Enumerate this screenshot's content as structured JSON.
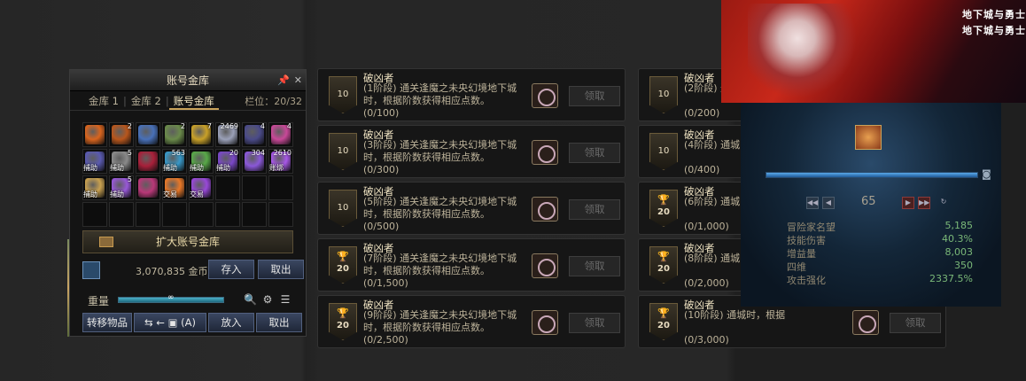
{
  "storage": {
    "title": "账号金库",
    "pin_icon": "pin-icon",
    "close_label": "✕",
    "tabs": [
      {
        "label": "金库 1"
      },
      {
        "label": "金库 2"
      },
      {
        "label": "账号金库"
      }
    ],
    "slots": "栏位：20/32",
    "items": [
      {
        "icon": "orange-mask",
        "color": "#d8641e",
        "count": "",
        "tag": ""
      },
      {
        "icon": "orange-golem",
        "color": "#b8561c",
        "count": "2",
        "tag": ""
      },
      {
        "icon": "blue-golem",
        "color": "#4870b8",
        "count": "",
        "tag": ""
      },
      {
        "icon": "green-bot",
        "color": "#6a8a4a",
        "count": "2",
        "tag": ""
      },
      {
        "icon": "gold-scroll",
        "color": "#c8a028",
        "count": "7",
        "tag": ""
      },
      {
        "icon": "silver-card",
        "color": "#9aa0b8",
        "count": "2469",
        "tag": ""
      },
      {
        "icon": "rune-stone",
        "color": "#4a4a88",
        "count": "4",
        "tag": ""
      },
      {
        "icon": "pink-orb",
        "color": "#c84898",
        "count": "4",
        "tag": ""
      },
      {
        "icon": "rune-box",
        "color": "#5a5ab0",
        "count": "",
        "tag": "捕助"
      },
      {
        "icon": "hammer-tools",
        "color": "#8a8a8a",
        "count": "5",
        "tag": "捕助"
      },
      {
        "icon": "red-potion",
        "color": "#a8203a",
        "count": "",
        "tag": ""
      },
      {
        "icon": "blue-crystal",
        "color": "#3898c8",
        "count": "563",
        "tag": "捕助"
      },
      {
        "icon": "green-flask",
        "color": "#58a848",
        "count": "",
        "tag": "捕助"
      },
      {
        "icon": "purple-gem",
        "color": "#7a48c8",
        "count": "20",
        "tag": "捕助"
      },
      {
        "icon": "purple-ring",
        "color": "#8a58d8",
        "count": "304",
        "tag": ""
      },
      {
        "icon": "violet-rune",
        "color": "#a858e8",
        "count": "2610",
        "tag": "账绑"
      },
      {
        "icon": "amber-jar",
        "color": "#c8a050",
        "count": "",
        "tag": "捕助"
      },
      {
        "icon": "magic-wand",
        "color": "#9858d8",
        "count": "5",
        "tag": "捕助"
      },
      {
        "icon": "pink-chest",
        "color": "#b83878",
        "count": "",
        "tag": ""
      },
      {
        "icon": "fire-orb",
        "color": "#e87828",
        "count": "",
        "tag": "交易"
      },
      {
        "icon": "violet-orb",
        "color": "#9848d8",
        "count": "",
        "tag": "交易"
      },
      {
        "icon": "",
        "color": "",
        "count": "",
        "tag": ""
      },
      {
        "icon": "",
        "color": "",
        "count": "",
        "tag": ""
      },
      {
        "icon": "",
        "color": "",
        "count": "",
        "tag": ""
      },
      {
        "icon": "",
        "color": "",
        "count": "",
        "tag": ""
      },
      {
        "icon": "",
        "color": "",
        "count": "",
        "tag": ""
      },
      {
        "icon": "",
        "color": "",
        "count": "",
        "tag": ""
      },
      {
        "icon": "",
        "color": "",
        "count": "",
        "tag": ""
      },
      {
        "icon": "",
        "color": "",
        "count": "",
        "tag": ""
      },
      {
        "icon": "",
        "color": "",
        "count": "",
        "tag": ""
      },
      {
        "icon": "",
        "color": "",
        "count": "",
        "tag": ""
      },
      {
        "icon": "",
        "color": "",
        "count": "",
        "tag": ""
      }
    ],
    "expand_label": "扩大账号金库",
    "gold_amount": "3,070,835",
    "gold_unit": "金币",
    "deposit_label": "存入",
    "withdraw_label": "取出",
    "weight_label": "重量",
    "weight_value": "∞",
    "transfer_label": "转移物品",
    "transfer_hotkey": "(A)",
    "put_label": "放入",
    "take_label": "取出"
  },
  "achievements": {
    "claim_label": "领取",
    "left": [
      {
        "name": "破凶者",
        "desc": "(1阶段) 通关逢魔之未央幻境地下城时，根据阶数获得相应点数。",
        "progress": "(0/100)",
        "medal": "10",
        "trophy": false
      },
      {
        "name": "破凶者",
        "desc": "(3阶段) 通关逢魔之未央幻境地下城时，根据阶数获得相应点数。",
        "progress": "(0/300)",
        "medal": "10",
        "trophy": false
      },
      {
        "name": "破凶者",
        "desc": "(5阶段) 通关逢魔之未央幻境地下城时，根据阶数获得相应点数。",
        "progress": "(0/500)",
        "medal": "10",
        "trophy": false
      },
      {
        "name": "破凶者",
        "desc": "(7阶段) 通关逢魔之未央幻境地下城时，根据阶数获得相应点数。",
        "progress": "(0/1,500)",
        "medal": "20",
        "trophy": true
      },
      {
        "name": "破凶者",
        "desc": "(9阶段) 通关逢魔之未央幻境地下城时，根据阶数获得相应点数。",
        "progress": "(0/2,500)",
        "medal": "20",
        "trophy": true
      }
    ],
    "right": [
      {
        "name": "破凶者",
        "desc": "(2阶段) 通城时，根据",
        "progress": "(0/200)",
        "medal": "10",
        "trophy": false
      },
      {
        "name": "破凶者",
        "desc": "(4阶段) 通城时，根据",
        "progress": "(0/400)",
        "medal": "10",
        "trophy": false
      },
      {
        "name": "破凶者",
        "desc": "(6阶段) 通城时，根据",
        "progress": "(0/1,000)",
        "medal": "20",
        "trophy": true
      },
      {
        "name": "破凶者",
        "desc": "(8阶段) 通城时，根据",
        "progress": "(0/2,000)",
        "medal": "20",
        "trophy": true
      },
      {
        "name": "破凶者",
        "desc": "(10阶段) 通城时，根据",
        "progress": "(0/3,000)",
        "medal": "20",
        "trophy": true
      }
    ]
  },
  "banner": {
    "logo1": "地下城与勇士",
    "logo2": "地下城与勇士"
  },
  "stats": {
    "level": "65",
    "xp_fraction": 1.0,
    "rows": [
      {
        "label": "冒险家名望",
        "value": "5,185"
      },
      {
        "label": "技能伤害",
        "value": "40.3%"
      },
      {
        "label": "增益量",
        "value": "8,003"
      },
      {
        "label": "四维",
        "value": "350"
      },
      {
        "label": "攻击强化",
        "value": "2337.5%"
      }
    ]
  }
}
